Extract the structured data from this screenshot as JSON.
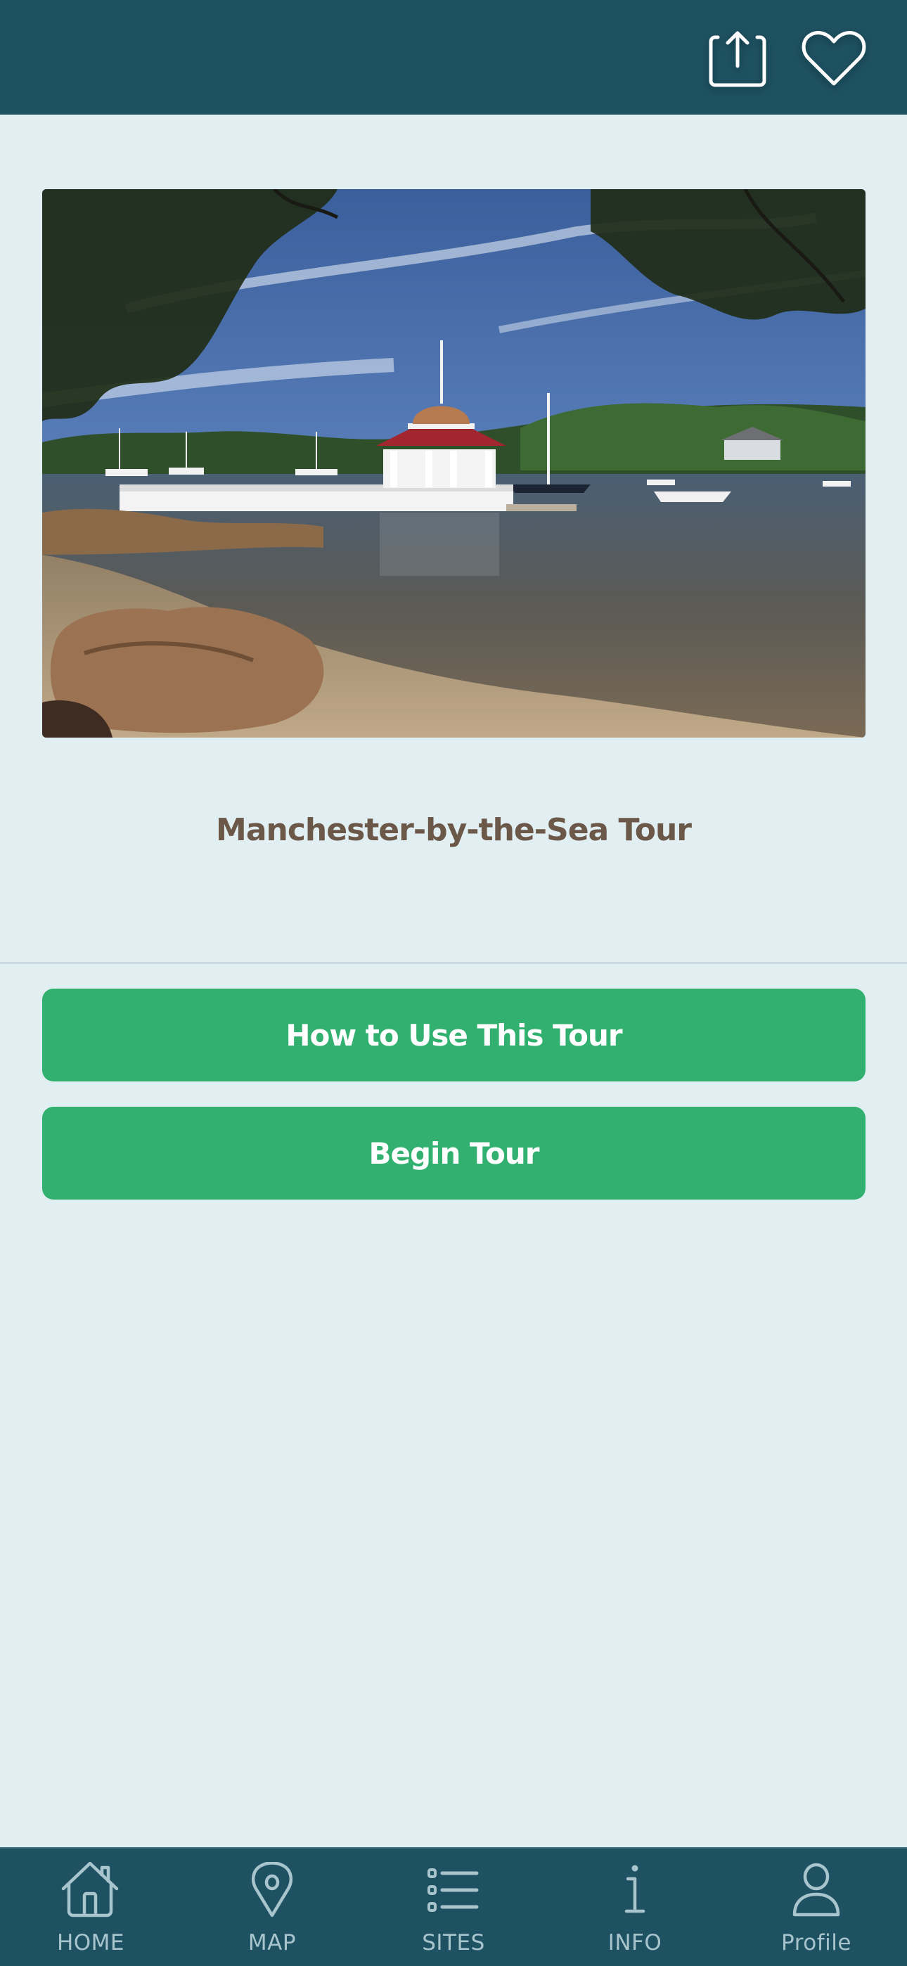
{
  "header": {
    "share_icon": "share-icon",
    "favorite_icon": "heart-icon",
    "background_color": "#1e5262"
  },
  "hero": {
    "alt": "Harbor view with white gazebo with copper dome and red roof on pier, sailboats, rocky shore"
  },
  "tour": {
    "title": "Manchester-by-the-Sea Tour",
    "title_color": "#6b5848"
  },
  "actions": {
    "how_to_use_label": "How to Use This Tour",
    "begin_tour_label": "Begin Tour",
    "button_color": "#31b070"
  },
  "tabbar": {
    "items": [
      {
        "label": "HOME",
        "icon": "home-icon"
      },
      {
        "label": "MAP",
        "icon": "map-pin-icon"
      },
      {
        "label": "SITES",
        "icon": "list-icon"
      },
      {
        "label": "INFO",
        "icon": "info-icon"
      },
      {
        "label": "Profile",
        "icon": "profile-icon"
      }
    ],
    "icon_color": "#a8c4cc"
  }
}
